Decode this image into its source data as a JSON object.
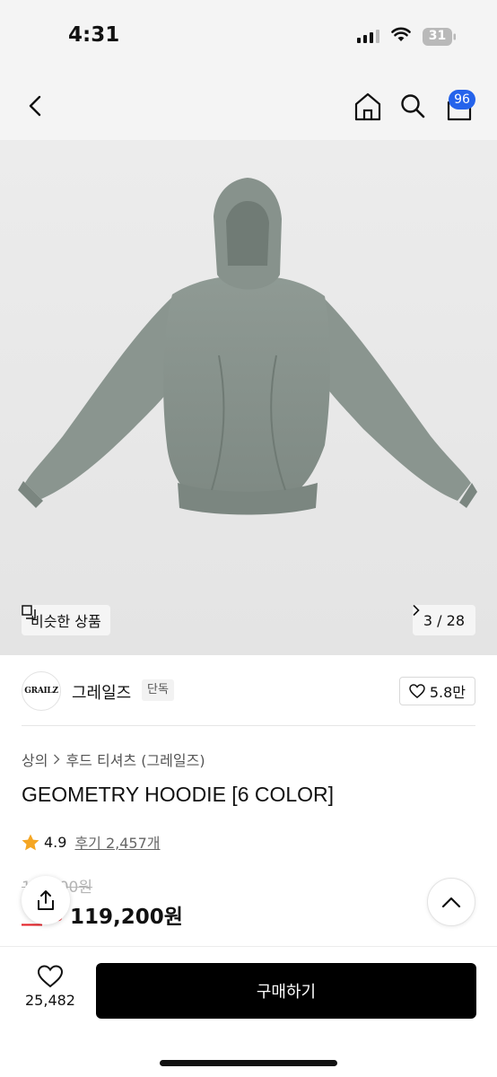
{
  "status_bar": {
    "time": "4:31",
    "battery": "31"
  },
  "nav": {
    "cart_badge": "96",
    "icons": [
      "back-icon",
      "home-icon",
      "search-icon",
      "cart-icon"
    ]
  },
  "hero": {
    "similar_label": "비슷한 상품",
    "page_current": "3",
    "page_total": "28",
    "page_label": "3 / 28"
  },
  "brand": {
    "logo_text": "GRAILZ",
    "name": "그레일즈",
    "tag": "단독",
    "likes": "5.8만"
  },
  "breadcrumb": {
    "category": "상의",
    "subcategory": "후드 티셔츠 (그레일즈)"
  },
  "product": {
    "name": "GEOMETRY HOODIE [6 COLOR]",
    "rating": "4.9",
    "review_text": "후기 2,457개",
    "original_price": "1__,_00원",
    "discount": "__%",
    "price": "119,200원"
  },
  "bottom_bar": {
    "wish_count": "25,482",
    "buy_label": "구매하기"
  },
  "colors": {
    "accent_blue": "#2563eb",
    "discount_red": "#e4262c",
    "buy_button": "#000000",
    "star": "#f5a623"
  }
}
